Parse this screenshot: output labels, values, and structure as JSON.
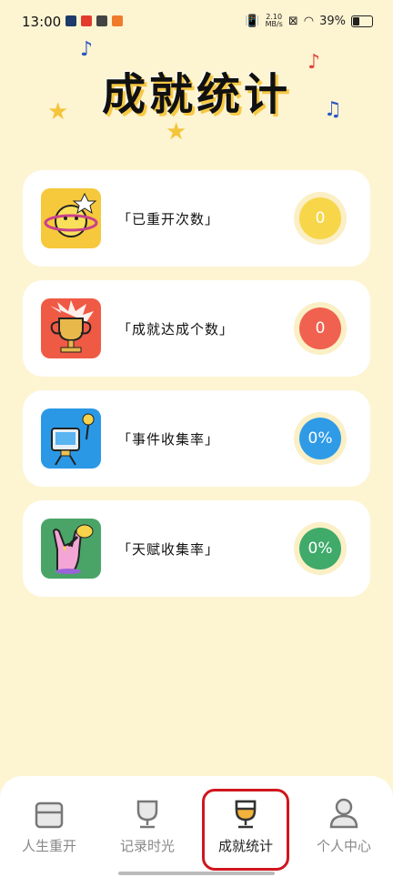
{
  "status_bar": {
    "time": "13:00",
    "net_speed_top": "2.10",
    "net_speed_bottom": "MB/s",
    "battery": "39%"
  },
  "page": {
    "title": "成就统计"
  },
  "stats": [
    {
      "label": "「已重开次数」",
      "value": "0",
      "color": "#f7d64a",
      "icon": "planet-icon"
    },
    {
      "label": "「成就达成个数」",
      "value": "0",
      "color": "#f0614f",
      "icon": "trophy-icon"
    },
    {
      "label": "「事件收集率」",
      "value": "0%",
      "color": "#2f9be7",
      "icon": "computer-mascot-icon"
    },
    {
      "label": "「天赋收集率」",
      "value": "0%",
      "color": "#3faa6a",
      "icon": "rock-hand-icon"
    }
  ],
  "nav": {
    "tabs": [
      {
        "label": "人生重开",
        "icon": "box-icon"
      },
      {
        "label": "记录时光",
        "icon": "cup-icon"
      },
      {
        "label": "成就统计",
        "icon": "trophy-icon"
      },
      {
        "label": "个人中心",
        "icon": "person-icon"
      }
    ],
    "active_index": 2
  }
}
